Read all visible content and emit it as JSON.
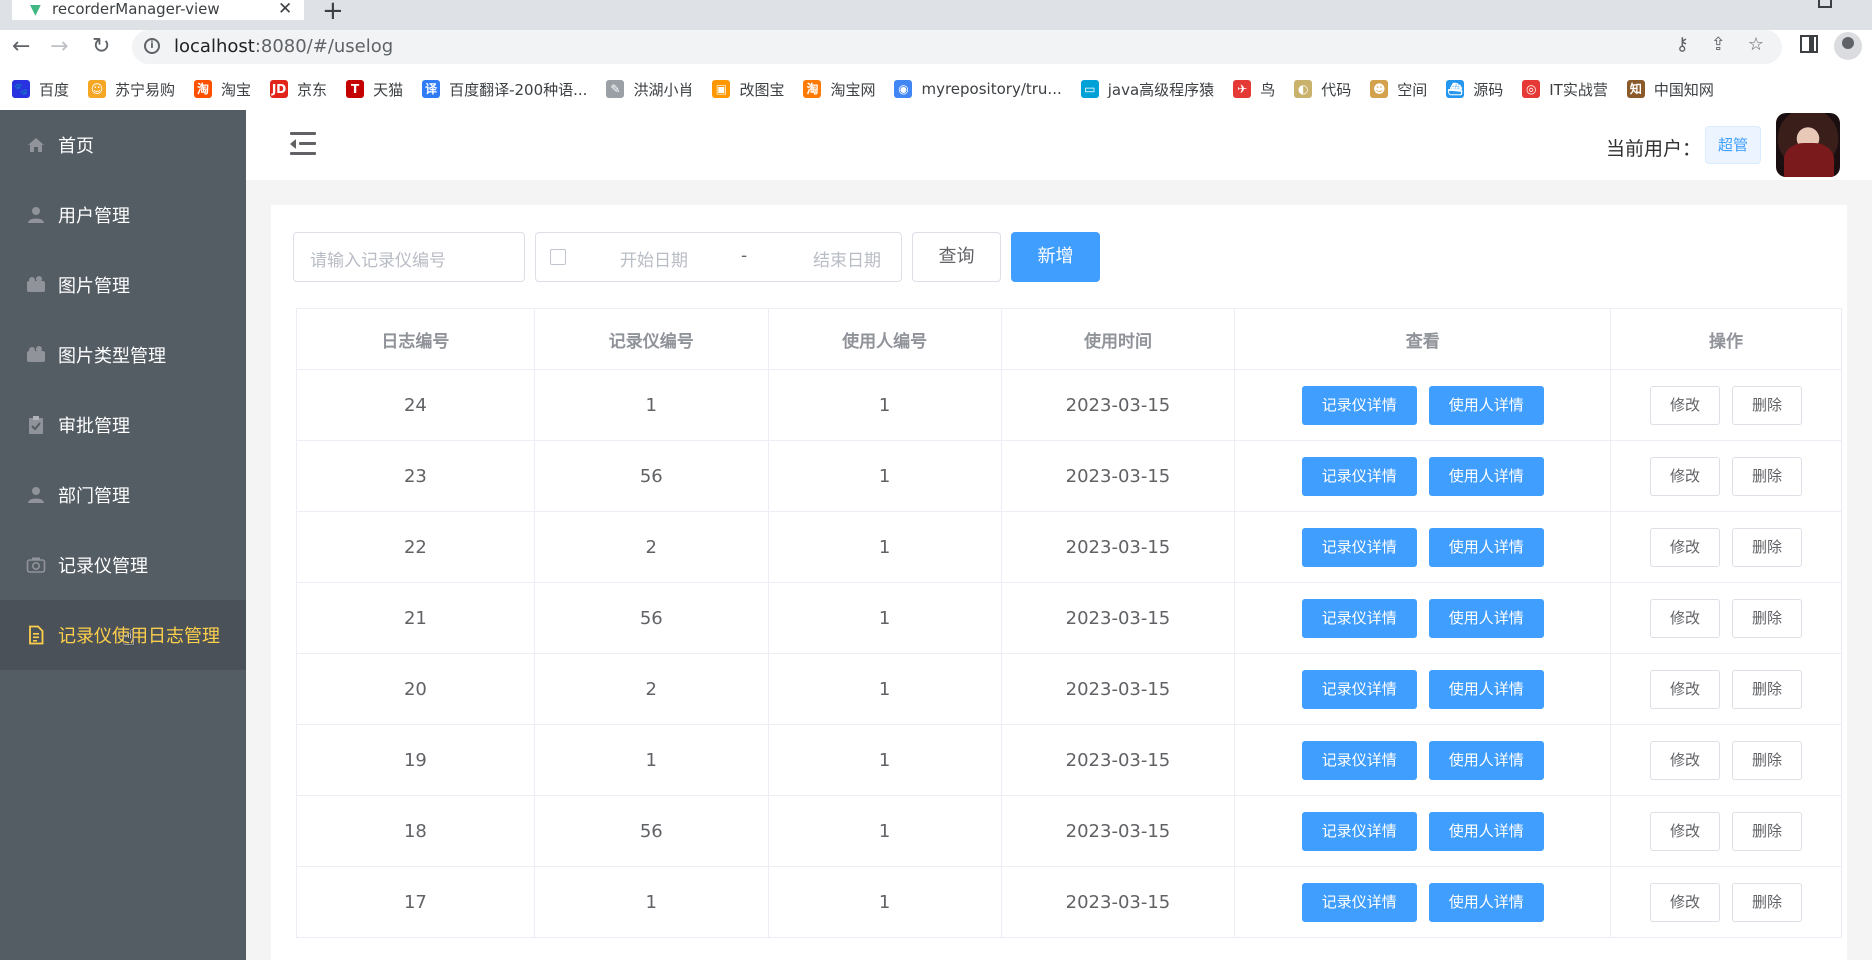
{
  "browser": {
    "tab_title": "recorderManager-view",
    "url_host": "localhost",
    "url_path": ":8080/#/uselog",
    "bookmarks": [
      {
        "label": "百度",
        "icon": "baidu-icon",
        "color": "#2932e1",
        "glyph": "🐾"
      },
      {
        "label": "苏宁易购",
        "icon": "suning-icon",
        "color": "#f5a623",
        "glyph": "☺"
      },
      {
        "label": "淘宝",
        "icon": "taobao-icon",
        "color": "#ff5000",
        "glyph": "淘"
      },
      {
        "label": "京东",
        "icon": "jd-icon",
        "color": "#e1251b",
        "glyph": "JD"
      },
      {
        "label": "天猫",
        "icon": "tmall-icon",
        "color": "#c40000",
        "glyph": "T"
      },
      {
        "label": "百度翻译-200种语...",
        "icon": "baidu-translate-icon",
        "color": "#2f7cf6",
        "glyph": "译"
      },
      {
        "label": "洪湖小肖",
        "icon": "bird-icon",
        "color": "#9aa0a6",
        "glyph": "✎"
      },
      {
        "label": "改图宝",
        "icon": "gaitubao-icon",
        "color": "#ff9800",
        "glyph": "▣"
      },
      {
        "label": "淘宝网",
        "icon": "taobao-net-icon",
        "color": "#ff7a00",
        "glyph": "淘"
      },
      {
        "label": "myrepository/tru...",
        "icon": "chrome-icon",
        "color": "#4285f4",
        "glyph": "◉"
      },
      {
        "label": "java高级程序猿",
        "icon": "bilibili-icon",
        "color": "#00a1d6",
        "glyph": "▭"
      },
      {
        "label": "鸟",
        "icon": "red-bird-icon",
        "color": "#e53935",
        "glyph": "✈"
      },
      {
        "label": "代码",
        "icon": "code-icon",
        "color": "#c9b26b",
        "glyph": "◐"
      },
      {
        "label": "空间",
        "icon": "space-icon",
        "color": "#d4a24c",
        "glyph": "☻"
      },
      {
        "label": "源码",
        "icon": "docker-icon",
        "color": "#2496ed",
        "glyph": "⛴"
      },
      {
        "label": "IT实战营",
        "icon": "it-camp-icon",
        "color": "#e53935",
        "glyph": "◎"
      },
      {
        "label": "中国知网",
        "icon": "cnki-icon",
        "color": "#8b5a2b",
        "glyph": "知"
      }
    ]
  },
  "sidebar": {
    "items": [
      {
        "label": "首页",
        "icon": "home-icon"
      },
      {
        "label": "用户管理",
        "icon": "user-icon"
      },
      {
        "label": "图片管理",
        "icon": "picture-icon"
      },
      {
        "label": "图片类型管理",
        "icon": "picture-type-icon"
      },
      {
        "label": "审批管理",
        "icon": "clipboard-icon"
      },
      {
        "label": "部门管理",
        "icon": "department-icon"
      },
      {
        "label": "记录仪管理",
        "icon": "camera-icon"
      },
      {
        "label": "记录仪使用日志管理",
        "icon": "document-icon"
      }
    ],
    "active_index": 7
  },
  "header": {
    "current_user_label": "当前用户：",
    "role": "超管"
  },
  "filters": {
    "recorder_placeholder": "请输入记录仪编号",
    "start_date_placeholder": "开始日期",
    "range_separator": "-",
    "end_date_placeholder": "结束日期",
    "query_label": "查询",
    "add_label": "新增"
  },
  "table": {
    "columns": [
      "日志编号",
      "记录仪编号",
      "使用人编号",
      "使用时间",
      "查看",
      "操作"
    ],
    "rows": [
      {
        "id": "24",
        "recorder": "1",
        "user": "1",
        "time": "2023-03-15"
      },
      {
        "id": "23",
        "recorder": "56",
        "user": "1",
        "time": "2023-03-15"
      },
      {
        "id": "22",
        "recorder": "2",
        "user": "1",
        "time": "2023-03-15"
      },
      {
        "id": "21",
        "recorder": "56",
        "user": "1",
        "time": "2023-03-15"
      },
      {
        "id": "20",
        "recorder": "2",
        "user": "1",
        "time": "2023-03-15"
      },
      {
        "id": "19",
        "recorder": "1",
        "user": "1",
        "time": "2023-03-15"
      },
      {
        "id": "18",
        "recorder": "56",
        "user": "1",
        "time": "2023-03-15"
      },
      {
        "id": "17",
        "recorder": "1",
        "user": "1",
        "time": "2023-03-15"
      }
    ],
    "view_buttons": {
      "recorder_detail": "记录仪详情",
      "user_detail": "使用人详情"
    },
    "op_buttons": {
      "edit": "修改",
      "delete": "删除"
    }
  }
}
